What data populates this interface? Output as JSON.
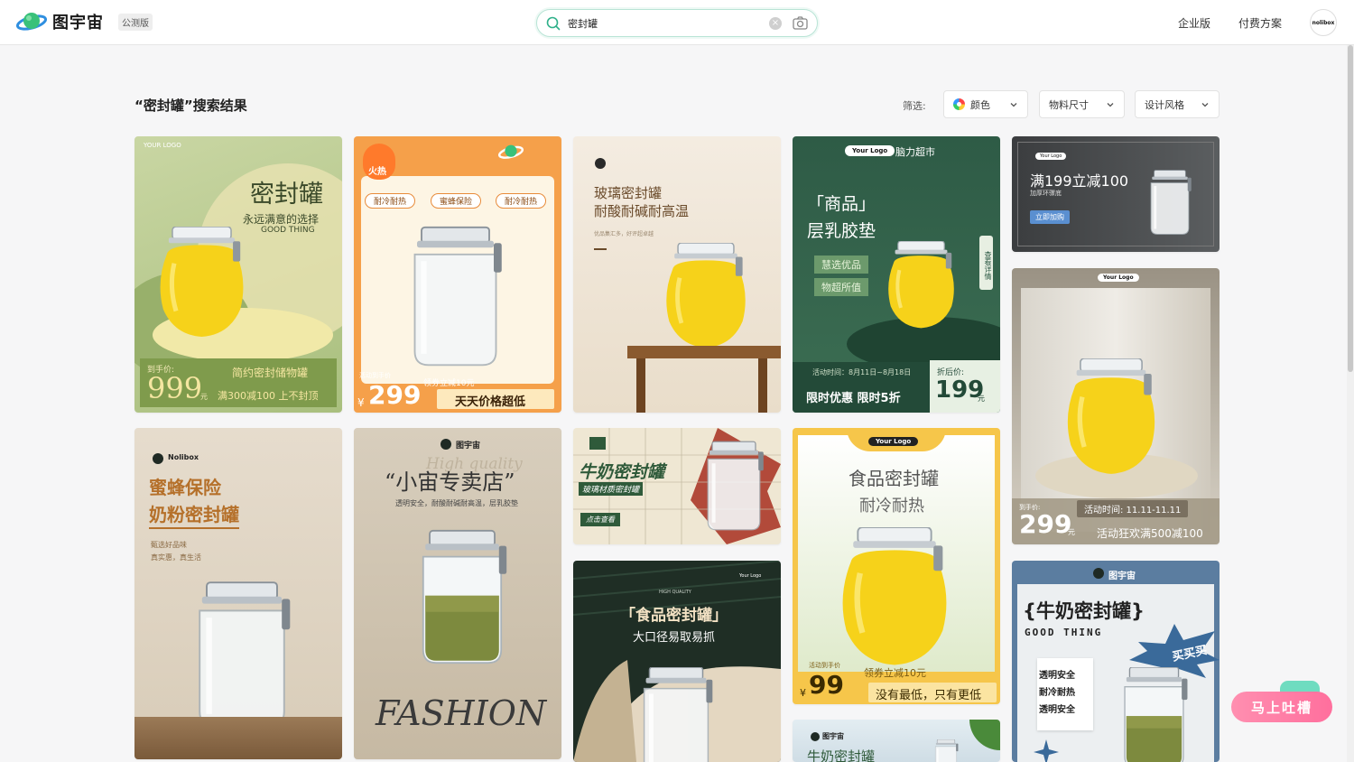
{
  "header": {
    "brand": "图宇宙",
    "beta_badge": "公测版",
    "search_value": "密封罐",
    "nav": [
      "企业版",
      "付费方案"
    ],
    "avatar_text": "nolibox"
  },
  "results": {
    "title": "“密封罐”搜索结果",
    "filter_label": "筛选:",
    "filters": [
      "颜色",
      "物料尺寸",
      "设计风格"
    ]
  },
  "cards": {
    "c1": {
      "logo": "YOUR LOGO",
      "title": "密封罐",
      "sub": "永远满意的选择",
      "en": "GOOD THING",
      "price_label": "到手价:",
      "price": "999",
      "unit": "元",
      "tag": "简约密封储物罐",
      "promo": "满300减100 上不封顶"
    },
    "c2": {
      "hot": "火热",
      "tags": [
        "耐冷耐热",
        "蜜蜂保险",
        "耐冷耐热"
      ],
      "price_label": "活动到手价",
      "coupon": "领券立减10元",
      "currency": "¥",
      "price": "299",
      "slogan": "天天价格超低"
    },
    "c3": {
      "title1": "玻璃密封罐",
      "title2": "耐酸耐碱耐高温",
      "sub": "优品集汇多，好评超卓越"
    },
    "c4": {
      "logo": "Your Logo",
      "store": "脑力超市",
      "title1": "「商品」",
      "title2": "层乳胶垫",
      "tag1": "慧选优品",
      "tag2": "物超所值",
      "side": "查看详情",
      "date": "活动时间：8月11日~8月18日",
      "price_label": "折后价:",
      "limit": "限时优惠 限时5折",
      "price": "199",
      "unit": "元"
    },
    "c5": {
      "logo": "Your Logo",
      "title": "满199立减100",
      "sub": "加厚环骤底",
      "button": "立即加购"
    },
    "c6": {
      "logo": "Your Logo",
      "price_label": "到手价:",
      "price": "299",
      "unit": "元",
      "date": "活动时间: 11.11-11.11",
      "promo": "活动狂欢满500减100"
    },
    "c7": {
      "logo": "Nolibox",
      "title1": "蜜蜂保险",
      "title2": "奶粉密封罐",
      "sub1": "甄选好品味",
      "sub2": "真实惠，真生活"
    },
    "c8": {
      "logo": "图宇宙",
      "ghost": "High quality",
      "title": "“小宙专卖店”",
      "sub": "透明安全，耐酸耐碱耐高温，层乳胶垫",
      "big": "FASHION"
    },
    "c9": {
      "title": "牛奶密封罐",
      "sub": "玻璃材质密封罐",
      "button": "点击查看"
    },
    "c10": {
      "hq": "HIGH QUALITY",
      "logo": "Your Logo",
      "title": "「食品密封罐」",
      "sub": "大口径易取易抓"
    },
    "c11": {
      "logo": "Your Logo",
      "title": "食品密封罐",
      "sub": "耐冷耐热",
      "price_label": "活动到手价",
      "coupon": "领券立减10元",
      "currency": "¥",
      "price": "99",
      "slogan": "没有最低，只有更低"
    },
    "c12": {
      "logo": "图宇宙",
      "title": "牛奶密封罐"
    },
    "c13": {
      "logo": "图宇宙",
      "title": "{牛奶密封罐}",
      "en": "GOOD THING",
      "burst": "买买买",
      "f1": "透明安全",
      "f2": "耐冷耐热",
      "f3": "透明安全"
    }
  },
  "feedback": "马上吐槽"
}
